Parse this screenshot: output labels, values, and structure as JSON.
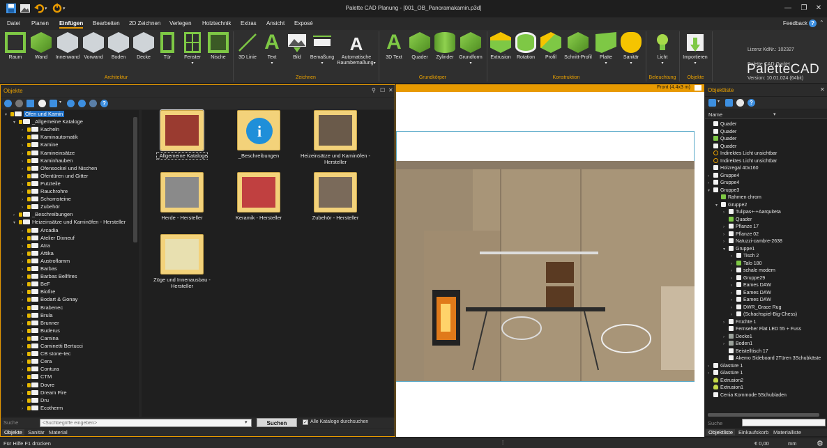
{
  "window": {
    "title": "Palette CAD Planung - [001_OB_Panoramakamin.p3d]"
  },
  "menu": {
    "items": [
      "Datei",
      "Planen",
      "Einfügen",
      "Bearbeiten",
      "2D Zeichnen",
      "Verlegen",
      "Holztechnik",
      "Extras",
      "Ansicht",
      "Exposé"
    ],
    "active": "Einfügen",
    "feedback": "Feedback"
  },
  "ribbon": {
    "architektur": {
      "label": "Architektur",
      "buttons": [
        "Raum",
        "Wand",
        "Innenwand",
        "Vorwand",
        "Boden",
        "Decke",
        "Tür",
        "Fenster",
        "Nische"
      ]
    },
    "zeichnen": {
      "label": "Zeichnen",
      "buttons": [
        "3D Linie",
        "Text",
        "Bild",
        "Bemaßung",
        "Automatische Raumbemaßung"
      ]
    },
    "grundkoerper": {
      "label": "Grundkörper",
      "buttons": [
        "3D Text",
        "Quader",
        "Zylinder",
        "Grundform"
      ]
    },
    "konstruktion": {
      "label": "Konstruktion",
      "buttons": [
        "Extrusion",
        "Rotation",
        "Profil",
        "Schnitt-Profil",
        "Platte",
        "Sanitär"
      ]
    },
    "beleuchtung": {
      "label": "Beleuchtung",
      "buttons": [
        "Licht"
      ]
    },
    "objekte": {
      "label": "Objekte",
      "buttons": [
        "Importieren"
      ]
    }
  },
  "logo": {
    "name": "PaletteCAD",
    "license": "Lizenz KdNr.: 102327",
    "company": "Palette CAD GmbH",
    "version": "Version: 10.01.024 (64bit)"
  },
  "objekte_panel": {
    "title": "Objekte",
    "tree": [
      {
        "label": "Ofen und Kamin",
        "level": 0,
        "expanded": true,
        "selected": true
      },
      {
        "label": "_Allgemeine Kataloge",
        "level": 1,
        "expanded": true
      },
      {
        "label": "Kacheln",
        "level": 2
      },
      {
        "label": "Kaminautomatik",
        "level": 2
      },
      {
        "label": "Kamine",
        "level": 2
      },
      {
        "label": "Kamineinsätze",
        "level": 2
      },
      {
        "label": "Kaminhauben",
        "level": 2
      },
      {
        "label": "Ofensockel und Nischen",
        "level": 2
      },
      {
        "label": "Ofentüren und Gitter",
        "level": 2
      },
      {
        "label": "Putzteile",
        "level": 2
      },
      {
        "label": "Rauchrohre",
        "level": 2
      },
      {
        "label": "Schornsteine",
        "level": 2
      },
      {
        "label": "Zubehör",
        "level": 2
      },
      {
        "label": "_Beschreibungen",
        "level": 1
      },
      {
        "label": "Heizeinsätze und Kaminöfen - Hersteller",
        "level": 1,
        "expanded": true
      },
      {
        "label": "Arcadia",
        "level": 2
      },
      {
        "label": "Atelier Dixneuf",
        "level": 2
      },
      {
        "label": "Atra",
        "level": 2
      },
      {
        "label": "Attika",
        "level": 2
      },
      {
        "label": "Austroflamm",
        "level": 2
      },
      {
        "label": "Barbas",
        "level": 2
      },
      {
        "label": "Barbas Bellfires",
        "level": 2
      },
      {
        "label": "BeF",
        "level": 2
      },
      {
        "label": "Biofire",
        "level": 2
      },
      {
        "label": "Bodart & Gonay",
        "level": 2
      },
      {
        "label": "Brabenec",
        "level": 2
      },
      {
        "label": "Brula",
        "level": 2
      },
      {
        "label": "Brunner",
        "level": 2
      },
      {
        "label": "Buderus",
        "level": 2
      },
      {
        "label": "Camina",
        "level": 2
      },
      {
        "label": "Caminetti Bertucci",
        "level": 2
      },
      {
        "label": "CB stone-tec",
        "level": 2
      },
      {
        "label": "Cera",
        "level": 2
      },
      {
        "label": "Contura",
        "level": 2
      },
      {
        "label": "CTM",
        "level": 2
      },
      {
        "label": "Dovre",
        "level": 2
      },
      {
        "label": "Dream Fire",
        "level": 2
      },
      {
        "label": "Dru",
        "level": 2
      },
      {
        "label": "Ecotherm",
        "level": 2
      }
    ],
    "gallery": [
      {
        "label": "_Allgemeine Kataloge",
        "selected": true
      },
      {
        "label": "_Beschreibungen"
      },
      {
        "label": "Heizeinsätze und Kaminöfen - Hersteller"
      },
      {
        "label": "Herde - Hersteller"
      },
      {
        "label": "Keramik - Hersteller"
      },
      {
        "label": "Zubehör - Hersteller"
      },
      {
        "label": "Züge und Innenausbau - Hersteller"
      }
    ],
    "search": {
      "label": "Suche",
      "placeholder": "<Suchbegriffe eingeben>",
      "button": "Suchen",
      "all_catalogs": "Alle Kataloge durchsuchen"
    },
    "tabs": [
      "Objekte",
      "Sanitär",
      "Material"
    ]
  },
  "viewport": {
    "label": "Front  (4.4x3 m)"
  },
  "objektliste": {
    "title": "Objektliste",
    "column": "Name",
    "items": [
      {
        "label": "Quader",
        "level": 0,
        "icon": "white"
      },
      {
        "label": "Quader",
        "level": 0,
        "icon": "white"
      },
      {
        "label": "Quader",
        "level": 0,
        "icon": "green"
      },
      {
        "label": "Quader",
        "level": 0,
        "icon": "white"
      },
      {
        "label": "Indirektes Licht unsichtbar",
        "level": 0,
        "icon": "ring"
      },
      {
        "label": "Indirektes Licht unsichtbar",
        "level": 0,
        "icon": "ring"
      },
      {
        "label": "Holzregal 40x160",
        "level": 0,
        "icon": "white"
      },
      {
        "label": "Gruppe4",
        "level": 0,
        "icon": "white",
        "arrow": ">"
      },
      {
        "label": "Gruppe4",
        "level": 0,
        "icon": "white",
        "arrow": ">"
      },
      {
        "label": "Gruppe3",
        "level": 0,
        "icon": "white",
        "arrow": "v"
      },
      {
        "label": "Rahmen chrom",
        "level": 1,
        "icon": "green"
      },
      {
        "label": "Gruppe2",
        "level": 1,
        "icon": "white",
        "arrow": "v"
      },
      {
        "label": "Tulipas+-+Aarquiteta",
        "level": 2,
        "icon": "white",
        "arrow": ">"
      },
      {
        "label": "Quader",
        "level": 2,
        "icon": "green"
      },
      {
        "label": "Pflanze 17",
        "level": 2,
        "icon": "white",
        "arrow": ">"
      },
      {
        "label": "Pflanze 02",
        "level": 2,
        "icon": "white",
        "arrow": ">"
      },
      {
        "label": "Natuzzi-cambre-2638",
        "level": 2,
        "icon": "white",
        "arrow": ">"
      },
      {
        "label": "Gruppe1",
        "level": 2,
        "icon": "white",
        "arrow": "v"
      },
      {
        "label": "Tisch 2",
        "level": 3,
        "icon": "white",
        "arrow": ">"
      },
      {
        "label": "Talo 180",
        "level": 3,
        "icon": "green",
        "arrow": ">"
      },
      {
        "label": "schale modern",
        "level": 3,
        "icon": "white",
        "arrow": ">"
      },
      {
        "label": "Gruppe29",
        "level": 3,
        "icon": "white",
        "arrow": ">"
      },
      {
        "label": "Eames DAW",
        "level": 3,
        "icon": "white",
        "arrow": ">"
      },
      {
        "label": "Eames DAW",
        "level": 3,
        "icon": "white",
        "arrow": ">"
      },
      {
        "label": "Eames DAW",
        "level": 3,
        "icon": "white",
        "arrow": ">"
      },
      {
        "label": "DWR_Grace Rug",
        "level": 3,
        "icon": "white",
        "arrow": ">"
      },
      {
        "label": "(Schachspiel-Big-Chess)",
        "level": 3,
        "icon": "white",
        "arrow": ">"
      },
      {
        "label": "Früchte 1",
        "level": 2,
        "icon": "white",
        "arrow": ">"
      },
      {
        "label": "Fernseher Flat LED 55 + Fuss",
        "level": 2,
        "icon": "white"
      },
      {
        "label": "Decke1",
        "level": 2,
        "icon": "gray",
        "arrow": ">"
      },
      {
        "label": "Boden1",
        "level": 2,
        "icon": "gray",
        "arrow": ">"
      },
      {
        "label": "Beistelltisch 17",
        "level": 2,
        "icon": "white"
      },
      {
        "label": "Akemo Sideboard 2Türen 3Schubkäste",
        "level": 2,
        "icon": "white"
      },
      {
        "label": "Glastüre 1",
        "level": 0,
        "icon": "white",
        "arrow": ">"
      },
      {
        "label": "Glastüre 1",
        "level": 0,
        "icon": "white",
        "arrow": ">"
      },
      {
        "label": "Extrusion2",
        "level": 0,
        "icon": "bulb"
      },
      {
        "label": "Extrusion1",
        "level": 0,
        "icon": "bulb"
      },
      {
        "label": "Cenia Kommode 5Schubladen",
        "level": 0,
        "icon": "white"
      }
    ],
    "search_label": "Suche",
    "tabs": [
      "Objektliste",
      "Einkaufskorb",
      "Materialliste"
    ]
  },
  "status": {
    "help": "Für Hilfe F1 drücken",
    "money": "€ 0,00",
    "unit": "mm"
  }
}
